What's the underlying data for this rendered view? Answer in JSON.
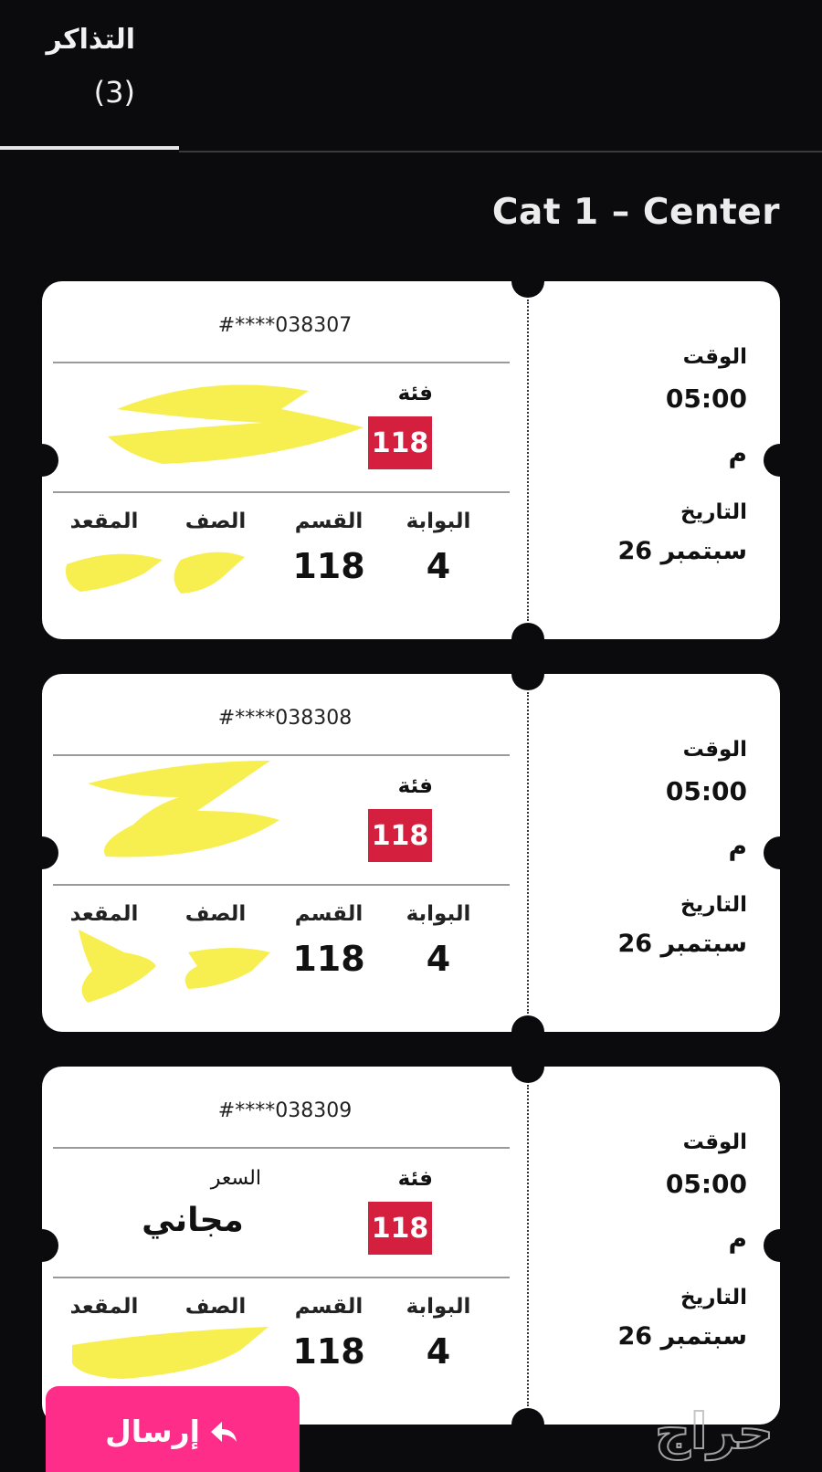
{
  "tab": {
    "title": "التذاكر",
    "count": "(3)"
  },
  "section_title": "Cat 1 – Center",
  "labels": {
    "category": "فئة",
    "price": "السعر",
    "gate": "البوابة",
    "section": "القسم",
    "row": "الصف",
    "seat": "المقعد",
    "time": "الوقت",
    "date": "التاريخ"
  },
  "tickets": [
    {
      "serial": "#****038307",
      "category": "118",
      "gate": "4",
      "section": "118",
      "time": "05:00",
      "ampm": "م",
      "date": "26 سبتمبر"
    },
    {
      "serial": "#****038308",
      "category": "118",
      "gate": "4",
      "section": "118",
      "time": "05:00",
      "ampm": "م",
      "date": "26 سبتمبر"
    },
    {
      "serial": "#****038309",
      "category": "118",
      "price": "مجاني",
      "gate": "4",
      "section": "118",
      "time": "05:00",
      "ampm": "م",
      "date": "26 سبتمبر"
    }
  ],
  "send_button": {
    "label": "إرسال"
  },
  "watermark": {
    "text": "حراج"
  },
  "colors": {
    "background": "#0b0a0d",
    "category_badge": "#d51f3f",
    "send_button": "#ff2d8a",
    "redaction": "#f7ee4f"
  }
}
